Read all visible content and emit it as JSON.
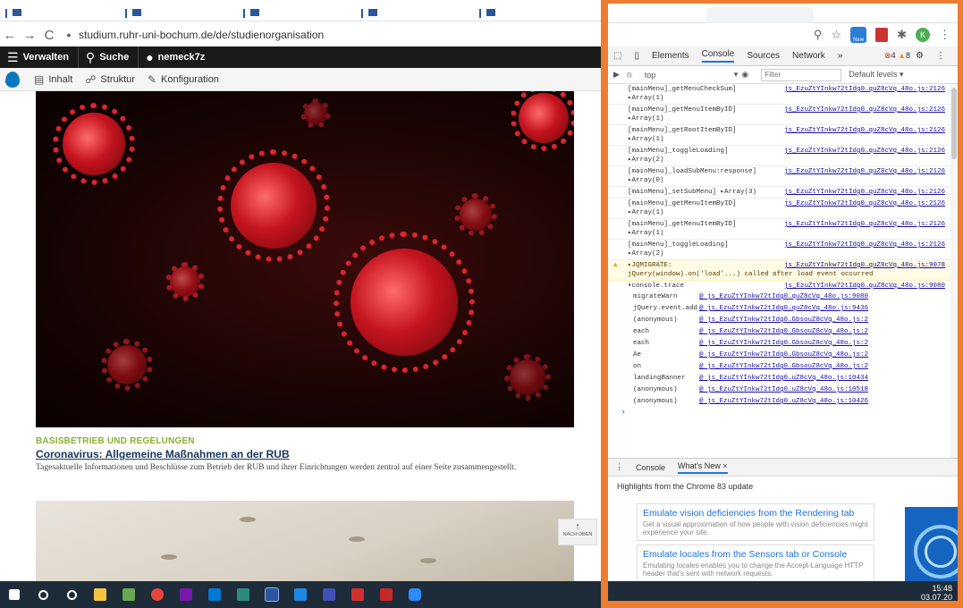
{
  "browser": {
    "url": "studium.ruhr-uni-bochum.de/de/studienorganisation",
    "back_icon": "←",
    "forward_icon": "→",
    "reload_icon": "C"
  },
  "adminbar": {
    "manage": "Verwalten",
    "search": "Suche",
    "user": "nemeck7z"
  },
  "toolbar_tray": {
    "content": "Inhalt",
    "structure": "Struktur",
    "config": "Konfiguration"
  },
  "article": {
    "category": "BASISBETRIEB UND REGELUNGEN",
    "headline": "Coronavirus: Allgemeine Maßnahmen an der RUB",
    "teaser": "Tagesaktuelle Informationen und Beschlüsse zum Betrieb der RUB und ihrer Einrichtungen werden zentral auf einer Seite zusammengestellt."
  },
  "back_to_top": "NACH OBEN",
  "browser_icons": {
    "new_badge": "New",
    "profile_initial": "K"
  },
  "devtools": {
    "tabs": [
      "Elements",
      "Console",
      "Sources",
      "Network"
    ],
    "more": "»",
    "error_count": "4",
    "warning_count": "8",
    "context": "top",
    "filter_placeholder": "Filter",
    "levels": "Default levels ▾",
    "messages": [
      {
        "text": "[mainMenu]_getMenuCheckSum]",
        "sub": "▸Array(1)",
        "src": "js_EzuZtYInkw72tIdg0…quZ8cVq_48o.js:2126"
      },
      {
        "text": "[mainMenu]_getMenuItemByID]",
        "sub": "▸Array(1)",
        "src": "js_EzuZtYInkw72tIdg0…quZ8cVq_48o.js:2126"
      },
      {
        "text": "[mainMenu]_getRootItemByID]",
        "sub": "▸Array(1)",
        "src": "js_EzuZtYInkw72tIdg0…quZ8cVq_48o.js:2126"
      },
      {
        "text": "[mainMenu]_toggleLoading]",
        "sub": "▸Array(2)",
        "src": "js_EzuZtYInkw72tIdg0…quZ8cVq_48o.js:2126"
      },
      {
        "text": "[mainMenu]_loadSubMenu:response]",
        "sub": "▸Array(0)",
        "src": "js_EzuZtYInkw72tIdg0…quZ8cVq_48o.js:2126"
      },
      {
        "text": "[mainMenu]_setSubMenu] ▸Array(3)",
        "sub": "",
        "src": "js_EzuZtYInkw72tIdg0…quZ8cVq_48o.js:2126"
      },
      {
        "text": "[mainMenu]_getMenuItemByID]",
        "sub": "▸Array(1)",
        "src": "js_EzuZtYInkw72tIdg0…quZ8cVq_48o.js:2126"
      },
      {
        "text": "[mainMenu]_getMenuItemByID]",
        "sub": "▸Array(1)",
        "src": "js_EzuZtYInkw72tIdg0…quZ8cVq_48o.js:2126"
      },
      {
        "text": "[mainMenu]_toggleLoading]",
        "sub": "▸Array(2)",
        "src": "js_EzuZtYInkw72tIdg0…quZ8cVq_48o.js:2126"
      }
    ],
    "warning": {
      "text": "▸JQMIGRATE:",
      "detail": "jQuery(window).on('load'...) called after load event occurred",
      "src": "js_EzuZtYInkw72tIdg0…quZ8cVq_48o.js:9078"
    },
    "trace": {
      "header": "▾console.trace",
      "src": "js_EzuZtYInkw72tIdg0…quZ8cVq_48o.js:9080",
      "rows": [
        {
          "fn": "migrateWarn",
          "link": "@ js_EzuZtYInkw72tIdg0…quZ8cVq_48o.js:9080"
        },
        {
          "fn": "jQuery.event.add",
          "link": "@ js_EzuZtYInkw72tIdg0…quZ8cVq_48o.js:9436"
        },
        {
          "fn": "(anonymous)",
          "link": "@ js_EzuZtYInkw72tIdg0…GbsouZ8cVq_48o.js:2"
        },
        {
          "fn": "each",
          "link": "@ js_EzuZtYInkw72tIdg0…GbsouZ8cVq_48o.js:2"
        },
        {
          "fn": "each",
          "link": "@ js_EzuZtYInkw72tIdg0…GbsouZ8cVq_48o.js:2"
        },
        {
          "fn": "Ae",
          "link": "@ js_EzuZtYInkw72tIdg0…GbsouZ8cVq_48o.js:2"
        },
        {
          "fn": "on",
          "link": "@ js_EzuZtYInkw72tIdg0…GbsouZ8cVq_48o.js:2"
        },
        {
          "fn": "landingBanner",
          "link": "@ js_EzuZtYInkw72tIdg0…uZ8cVq_48o.js:10434"
        },
        {
          "fn": "(anonymous)",
          "link": "@ js_EzuZtYInkw72tIdg0…uZ8cVq_48o.js:10518"
        },
        {
          "fn": "(anonymous)",
          "link": "@ js_EzuZtYInkw72tIdg0…uZ8cVq_48o.js:10426"
        }
      ]
    },
    "prompt": "›",
    "drawer_tabs": [
      "Console",
      "What's New ×"
    ],
    "highlights": "Highlights from the Chrome 83 update",
    "whatsnew": [
      {
        "title": "Emulate vision deficiencies from the Rendering tab",
        "desc": "Get a visual approximation of how people with vision deficiencies might experience your site."
      },
      {
        "title": "Emulate locales from the Sensors tab or Console",
        "desc": "Emulating locales enables you to change the Accept-Language HTTP header that's sent with network requests."
      }
    ]
  },
  "clock": {
    "time": "15:48",
    "date": "03.07.20"
  }
}
